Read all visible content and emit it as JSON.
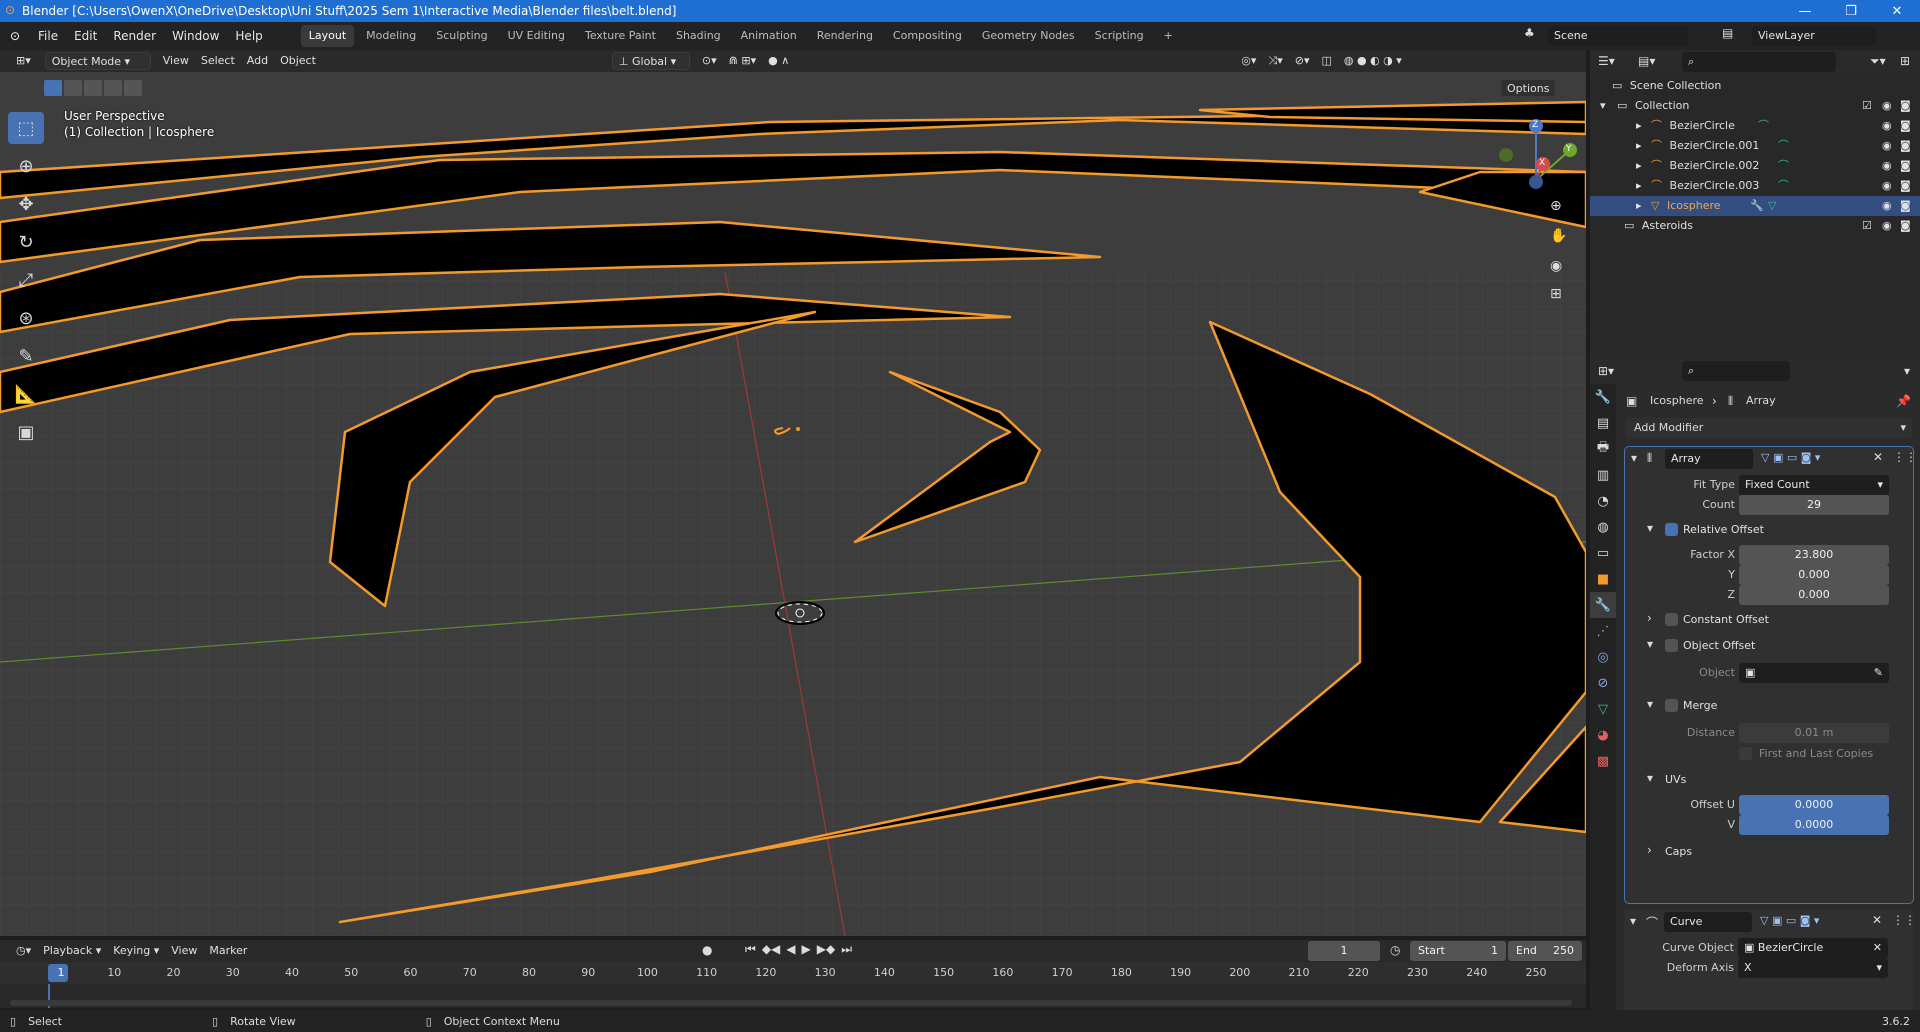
{
  "window": {
    "title": "Blender [C:\\Users\\OwenX\\OneDrive\\Desktop\\Uni Stuff\\2025 Sem 1\\Interactive Media\\Blender files\\belt.blend]"
  },
  "menus": [
    "File",
    "Edit",
    "Render",
    "Window",
    "Help"
  ],
  "workspaces": [
    "Layout",
    "Modeling",
    "Sculpting",
    "UV Editing",
    "Texture Paint",
    "Shading",
    "Animation",
    "Rendering",
    "Compositing",
    "Geometry Nodes",
    "Scripting"
  ],
  "active_workspace": "Layout",
  "scene": "Scene",
  "view_layer": "ViewLayer",
  "viewport_header": {
    "mode": "Object Mode",
    "view": "View",
    "select": "Select",
    "add": "Add",
    "object": "Object",
    "orientation": "Global",
    "options": "Options"
  },
  "viewport": {
    "perspective": "User Perspective",
    "context": "(1) Collection | Icosphere"
  },
  "outliner": {
    "rows": [
      {
        "label": "Scene Collection"
      },
      {
        "label": "Collection"
      },
      {
        "label": "BezierCircle"
      },
      {
        "label": "BezierCircle.001"
      },
      {
        "label": "BezierCircle.002"
      },
      {
        "label": "BezierCircle.003"
      },
      {
        "label": "Icosphere"
      },
      {
        "label": "Asteroids"
      }
    ]
  },
  "properties": {
    "breadcrumb_object": "Icosphere",
    "breadcrumb_modifier": "Array",
    "add_modifier": "Add Modifier",
    "array": {
      "name": "Array",
      "fit_type_label": "Fit Type",
      "fit_type": "Fixed Count",
      "count_label": "Count",
      "count": "29",
      "relative_offset": "Relative Offset",
      "factor_x_label": "Factor X",
      "factor_x": "23.800",
      "y_label": "Y",
      "y": "0.000",
      "z_label": "Z",
      "z": "0.000",
      "constant_offset": "Constant Offset",
      "object_offset": "Object Offset",
      "object_label": "Object",
      "merge": "Merge",
      "distance_label": "Distance",
      "distance": "0.01 m",
      "first_last": "First and Last Copies",
      "uvs": "UVs",
      "offset_u_label": "Offset U",
      "offset_u": "0.0000",
      "v_label": "V",
      "v": "0.0000",
      "caps": "Caps"
    },
    "curve": {
      "name": "Curve",
      "curve_object_label": "Curve Object",
      "curve_object": "BezierCircle",
      "deform_axis_label": "Deform Axis",
      "deform_axis": "X"
    }
  },
  "timeline": {
    "playback": "Playback",
    "keying": "Keying",
    "view": "View",
    "marker": "Marker",
    "current_frame": "1",
    "start_label": "Start",
    "start": "1",
    "end_label": "End",
    "end": "250",
    "ticks": [
      "1",
      "10",
      "20",
      "30",
      "40",
      "50",
      "60",
      "70",
      "80",
      "90",
      "100",
      "110",
      "120",
      "130",
      "140",
      "150",
      "160",
      "170",
      "180",
      "190",
      "200",
      "210",
      "220",
      "230",
      "240",
      "250"
    ]
  },
  "statusbar": {
    "select": "Select",
    "rotate": "Rotate View",
    "context_menu": "Object Context Menu",
    "version": "3.6.2"
  }
}
